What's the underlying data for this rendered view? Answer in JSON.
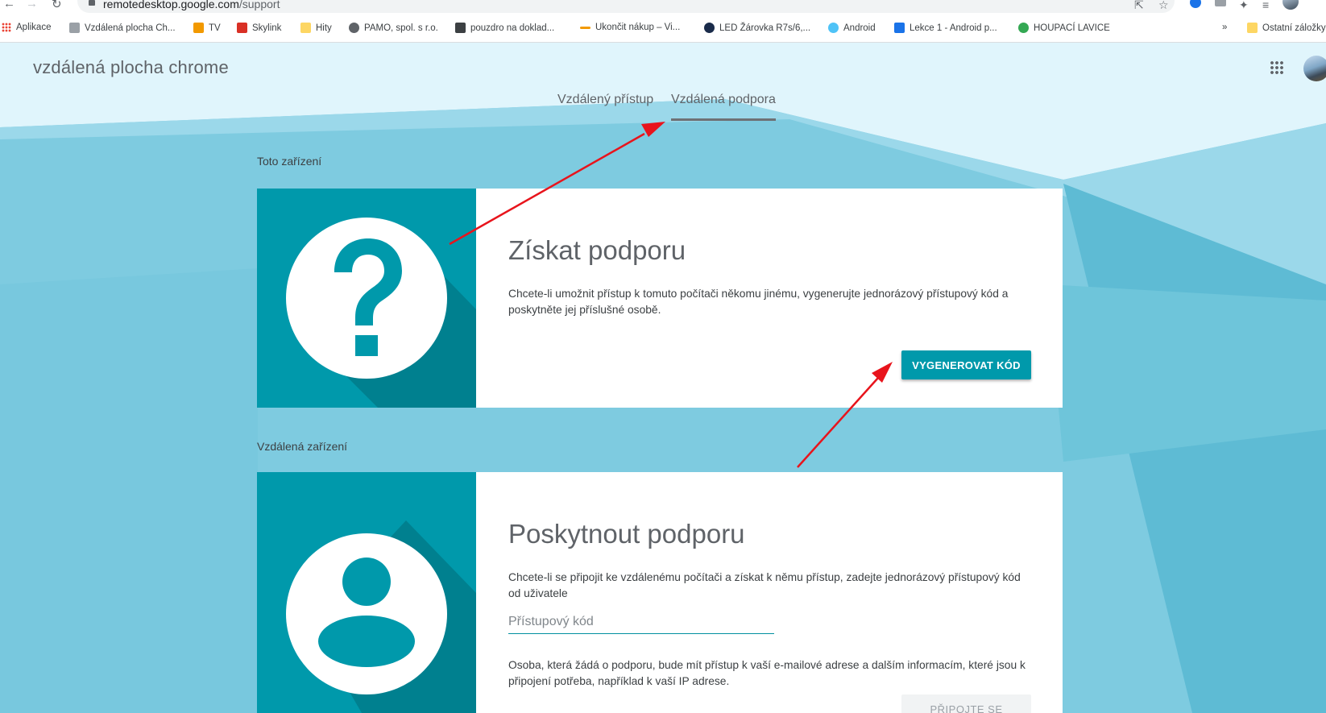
{
  "browser": {
    "url_host": "remotedesktop.google.com",
    "url_path": "/support",
    "bookmarks": [
      {
        "label": "Aplikace",
        "color": "#ea4335"
      },
      {
        "label": "Vzdálená plocha Ch...",
        "color": "#9aa0a6"
      },
      {
        "label": "TV",
        "color": "#f29900"
      },
      {
        "label": "Skylink",
        "color": "#d93025"
      },
      {
        "label": "Hity",
        "color": "#fdd663"
      },
      {
        "label": "PAMO, spol. s r.o.",
        "color": "#5f6368"
      },
      {
        "label": "pouzdro na doklad...",
        "color": "#3c4043"
      },
      {
        "label": "Ukončit nákup – Vi...",
        "color": "#f29900"
      },
      {
        "label": "LED Žárovka R7s/6,...",
        "color": "#1a2b4a"
      },
      {
        "label": "Android",
        "color": "#4fc3f7"
      },
      {
        "label": "Lekce 1 - Android p...",
        "color": "#1a73e8"
      },
      {
        "label": "HOUPACÍ LAVICE",
        "color": "#34a853"
      }
    ],
    "more": "»",
    "other_bookmarks": "Ostatní záložky"
  },
  "app": {
    "title": "vzdálená plocha chrome",
    "tabs": [
      {
        "label": "Vzdálený přístup",
        "active": false
      },
      {
        "label": "Vzdálená podpora",
        "active": true
      }
    ]
  },
  "get_support": {
    "section_label": "Toto zařízení",
    "title": "Získat podporu",
    "description": "Chcete-li umožnit přístup k tomuto počítači někomu jinému, vygenerujte jednorázový přístupový kód a poskytněte jej příslušné osobě.",
    "button_label": "VYGENEROVAT KÓD"
  },
  "give_support": {
    "section_label": "Vzdálená zařízení",
    "title": "Poskytnout podporu",
    "description": "Chcete-li se připojit ke vzdálenému počítači a získat k němu přístup, zadejte jednorázový přístupový kód od uživatele",
    "input_placeholder": "Přístupový kód",
    "input_value": "",
    "notice": "Osoba, která žádá o podporu, bude mít přístup k vaší e-mailové adrese a dalším informacím, které jsou k připojení potřeba, například k vaší IP adrese.",
    "button_label": "PŘIPOJTE SE"
  },
  "colors": {
    "accent": "#0099ab",
    "accent_dark": "#00838f",
    "annotation_arrow": "#e8141c",
    "header_bg": "#e1f5fc"
  },
  "icons": {
    "get_support": "question-mark-icon",
    "give_support": "person-icon"
  }
}
